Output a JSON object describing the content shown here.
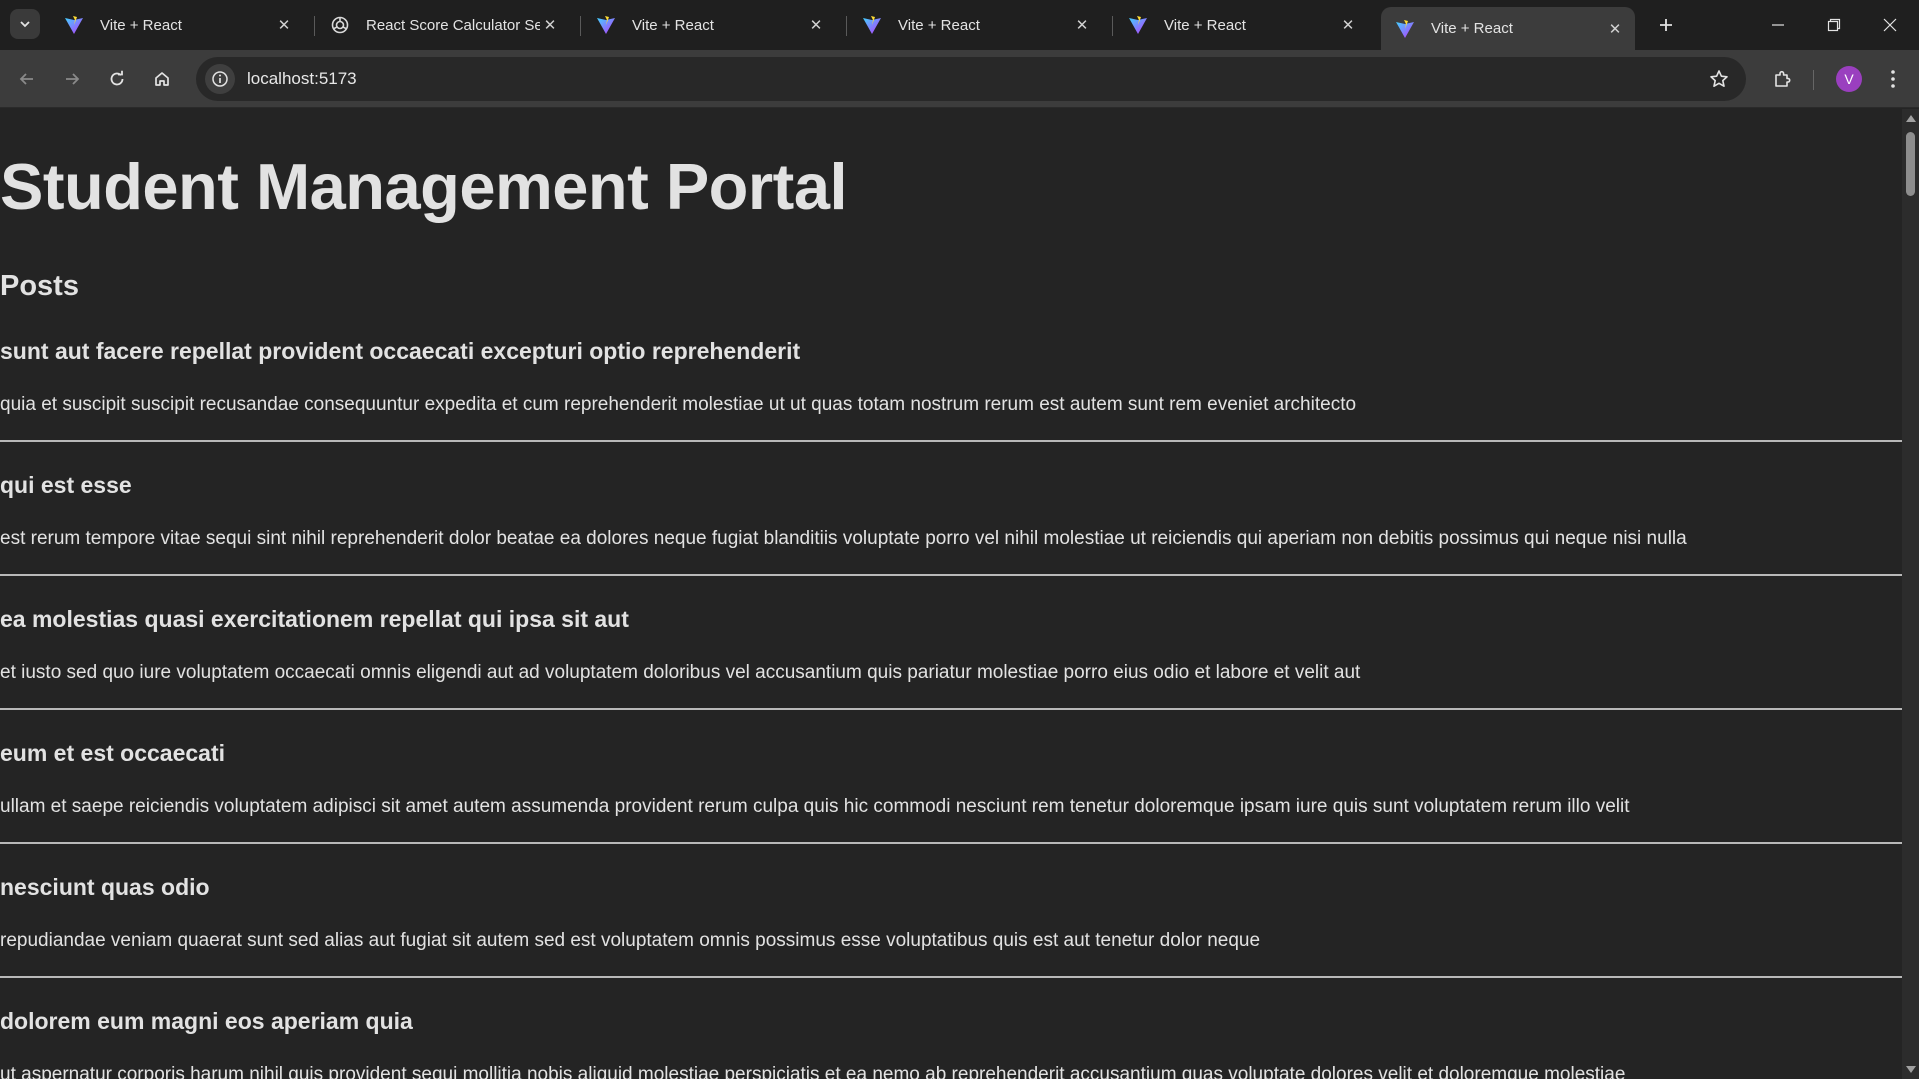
{
  "browser": {
    "tabs": [
      {
        "title": "Vite + React",
        "favicon": "vite-icon",
        "active": false
      },
      {
        "title": "React Score Calculator Setup",
        "favicon": "chatgpt-icon",
        "active": false
      },
      {
        "title": "Vite + React",
        "favicon": "vite-icon",
        "active": false
      },
      {
        "title": "Vite + React",
        "favicon": "vite-icon",
        "active": false
      },
      {
        "title": "Vite + React",
        "favicon": "vite-icon",
        "active": false
      },
      {
        "title": "Vite + React",
        "favicon": "vite-icon",
        "active": true
      }
    ],
    "url": "localhost:5173",
    "profile_initial": "V",
    "profile_color": "#9a3fbf"
  },
  "page": {
    "title": "Student Management Portal",
    "section_title": "Posts",
    "posts": [
      {
        "title": "sunt aut facere repellat provident occaecati excepturi optio reprehenderit",
        "body": "quia et suscipit suscipit recusandae consequuntur expedita et cum reprehenderit molestiae ut ut quas totam nostrum rerum est autem sunt rem eveniet architecto"
      },
      {
        "title": "qui est esse",
        "body": "est rerum tempore vitae sequi sint nihil reprehenderit dolor beatae ea dolores neque fugiat blanditiis voluptate porro vel nihil molestiae ut reiciendis qui aperiam non debitis possimus qui neque nisi nulla"
      },
      {
        "title": "ea molestias quasi exercitationem repellat qui ipsa sit aut",
        "body": "et iusto sed quo iure voluptatem occaecati omnis eligendi aut ad voluptatem doloribus vel accusantium quis pariatur molestiae porro eius odio et labore et velit aut"
      },
      {
        "title": "eum et est occaecati",
        "body": "ullam et saepe reiciendis voluptatem adipisci sit amet autem assumenda provident rerum culpa quis hic commodi nesciunt rem tenetur doloremque ipsam iure quis sunt voluptatem rerum illo velit"
      },
      {
        "title": "nesciunt quas odio",
        "body": "repudiandae veniam quaerat sunt sed alias aut fugiat sit autem sed est voluptatem omnis possimus esse voluptatibus quis est aut tenetur dolor neque"
      },
      {
        "title": "dolorem eum magni eos aperiam quia",
        "body": "ut aspernatur corporis harum nihil quis provident sequi mollitia nobis aliquid molestiae perspiciatis et ea nemo ab reprehenderit accusantium quas voluptate dolores velit et doloremque molestiae"
      }
    ]
  }
}
